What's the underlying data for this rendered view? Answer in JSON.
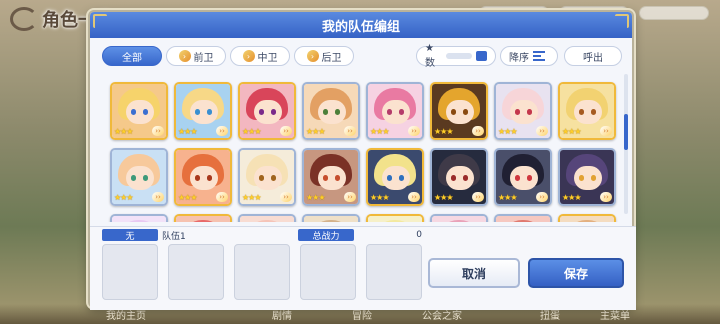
{
  "background": {
    "title": "角色一览",
    "bottom_labels": [
      "我的主页",
      "剧情",
      "冒险",
      "公会之家",
      "扭蛋",
      "主菜单"
    ]
  },
  "dialog": {
    "title": "我的队伍编组",
    "tabs": [
      {
        "label": "全部",
        "active": true
      },
      {
        "label": "前卫",
        "active": false
      },
      {
        "label": "中卫",
        "active": false
      },
      {
        "label": "后卫",
        "active": false
      }
    ],
    "sort": {
      "star_label": "★数",
      "order_label": "降序",
      "call_label": "呼出"
    },
    "rows": [
      [
        {
          "hair": "#f6d36b",
          "eyes": "#3b6fd1",
          "border": "gold",
          "bg": "#f5c98a"
        },
        {
          "hair": "#f7d887",
          "eyes": "#3a8fd1",
          "border": "gold",
          "bg": "#a8d2f0"
        },
        {
          "hair": "#d9455a",
          "eyes": "#7a2a8a",
          "border": "gold",
          "bg": "#f3b7c0"
        },
        {
          "hair": "#e3a063",
          "eyes": "#4d7f3a",
          "border": "silver",
          "bg": "#f6d9b8"
        },
        {
          "hair": "#e97aa2",
          "eyes": "#b43c6a",
          "border": "silver",
          "bg": "#f6d2e2"
        },
        {
          "hair": "#e4a52d",
          "eyes": "#8a4a10",
          "border": "gold",
          "bg": "#5a3a20"
        },
        {
          "hair": "#f7d5d8",
          "eyes": "#c4384c",
          "border": "silver",
          "bg": "#e8e2f0"
        },
        {
          "hair": "#f2d271",
          "eyes": "#a65a20",
          "border": "gold",
          "bg": "#f6e1a0"
        }
      ],
      [
        {
          "hair": "#f7c99b",
          "eyes": "#3e9a7a",
          "border": "silver",
          "bg": "#c9e0f4"
        },
        {
          "hair": "#e6703d",
          "eyes": "#a8391d",
          "border": "gold",
          "bg": "#f7b28e"
        },
        {
          "hair": "#f6e1b5",
          "eyes": "#a0641e",
          "border": "silver",
          "bg": "#f5ecda"
        },
        {
          "hair": "#7a3126",
          "eyes": "#c64d2d",
          "border": "silver",
          "bg": "#c79780"
        },
        {
          "hair": "#f2e28b",
          "eyes": "#2f6fbf",
          "border": "gold",
          "bg": "#3b4a6e"
        },
        {
          "hair": "#3f3a48",
          "eyes": "#9a2a2a",
          "border": "silver",
          "bg": "#262b3e"
        },
        {
          "hair": "#202033",
          "eyes": "#d0373f",
          "border": "silver",
          "bg": "#4a4f6a"
        },
        {
          "hair": "#56457a",
          "eyes": "#e2a233",
          "border": "silver",
          "bg": "#3a3555"
        }
      ],
      [
        {
          "hair": "#e9c9f2",
          "eyes": "#7a4ab8",
          "border": "silver",
          "bg": "#f2e2f8"
        },
        {
          "hair": "#e86a6a",
          "eyes": "#a33030",
          "border": "gold",
          "bg": "#f6c2b0"
        },
        {
          "hair": "#f5c4b8",
          "eyes": "#a05050",
          "border": "silver",
          "bg": "#f8dcd2"
        },
        {
          "hair": "#d4b28c",
          "eyes": "#7a5a30",
          "border": "silver",
          "bg": "#efe0c8"
        },
        {
          "hair": "#f3e9a0",
          "eyes": "#7aa23c",
          "border": "gold",
          "bg": "#f6f0c8"
        },
        {
          "hair": "#e9a2b8",
          "eyes": "#b84a6a",
          "border": "silver",
          "bg": "#f6d8e2"
        },
        {
          "hair": "#e07a70",
          "eyes": "#8a3a30",
          "border": "silver",
          "bg": "#f6c8c0"
        },
        {
          "hair": "#e3b080",
          "eyes": "#8a5a2a",
          "border": "gold",
          "bg": "#f4dcc0"
        }
      ]
    ],
    "stars": "★★★",
    "chevron": "››",
    "team": {
      "empty_label": "无",
      "name": "队伍1",
      "power_label": "总战力",
      "power_value": "0"
    },
    "buttons": {
      "cancel": "取消",
      "save": "保存"
    }
  }
}
